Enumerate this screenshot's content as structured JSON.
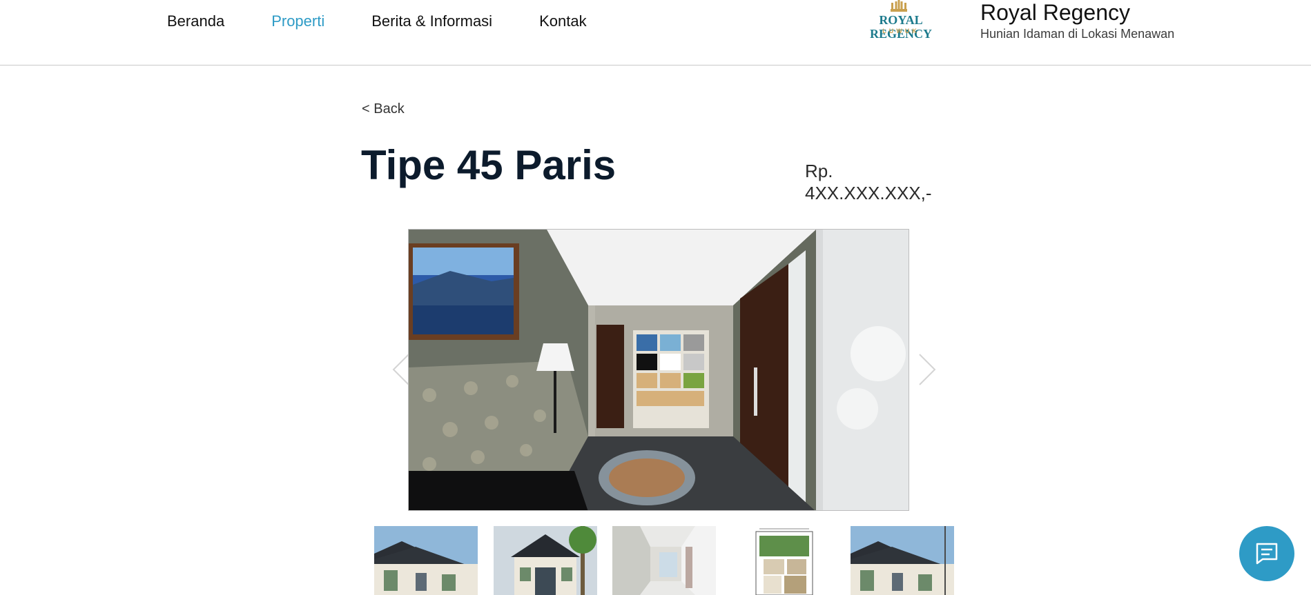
{
  "nav": {
    "items": [
      {
        "label": "Beranda",
        "active": false
      },
      {
        "label": "Properti",
        "active": true
      },
      {
        "label": "Berita & Informasi",
        "active": false
      },
      {
        "label": "Kontak",
        "active": false
      }
    ]
  },
  "logo": {
    "title": "ROYAL REGENCY",
    "subtitle": "LUWUK",
    "icon": "crown-icon",
    "colors": {
      "title": "#1c7a8c",
      "accent": "#c9a04f"
    }
  },
  "brand": {
    "name": "Royal Regency",
    "tagline": "Hunian Idaman di Lokasi Menawan"
  },
  "product": {
    "back_label": "< Back",
    "title": "Tipe 45 Paris",
    "price": "Rp. 4XX.XXX.XXX,-"
  },
  "gallery": {
    "prev_icon": "chevron-left-icon",
    "next_icon": "chevron-right-icon",
    "thumbnails": [
      {
        "subject": "house-exterior",
        "selected": false
      },
      {
        "subject": "house-front",
        "selected": false
      },
      {
        "subject": "interior-room",
        "selected": true
      },
      {
        "subject": "floor-plan",
        "selected": false
      },
      {
        "subject": "house-exterior",
        "selected": false
      }
    ]
  },
  "chat": {
    "icon": "chat-icon",
    "color": "#2e9bc6"
  },
  "colors": {
    "accent": "#2e9bc6",
    "title": "#0c1b2c"
  }
}
